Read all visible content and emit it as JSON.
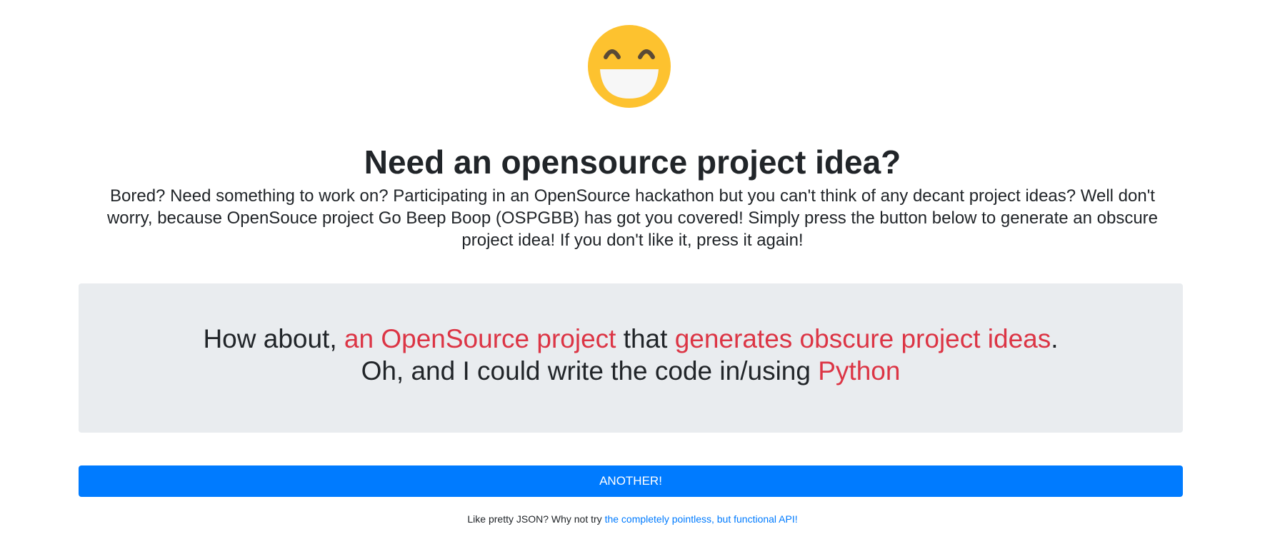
{
  "header": {
    "emoji_icon": "grinning-face-icon",
    "title": "Need an opensource project idea?",
    "intro": "Bored? Need something to work on? Participating in an OpenSource hackathon but you can't think of any decant project ideas? Well don't worry, because OpenSouce project Go Beep Boop (OSPGBB) has got you covered! Simply press the button below to generate an obscure project idea! If you don't like it, press it again!"
  },
  "idea": {
    "prefix": "How about, ",
    "subject": "an OpenSource project",
    "connector": " that ",
    "purpose": "generates obscure project ideas",
    "period": ".",
    "line2_prefix": "Oh, and I could write the code in/using ",
    "language": "Python"
  },
  "button": {
    "label": "ANOTHER!"
  },
  "footer": {
    "text": "Like pretty JSON? Why not try ",
    "link_text": "the completely pointless, but functional API!"
  },
  "colors": {
    "highlight": "#dc3545",
    "primary": "#007bff",
    "box_background": "#e9ecef",
    "emoji_face": "#fdc22f"
  }
}
